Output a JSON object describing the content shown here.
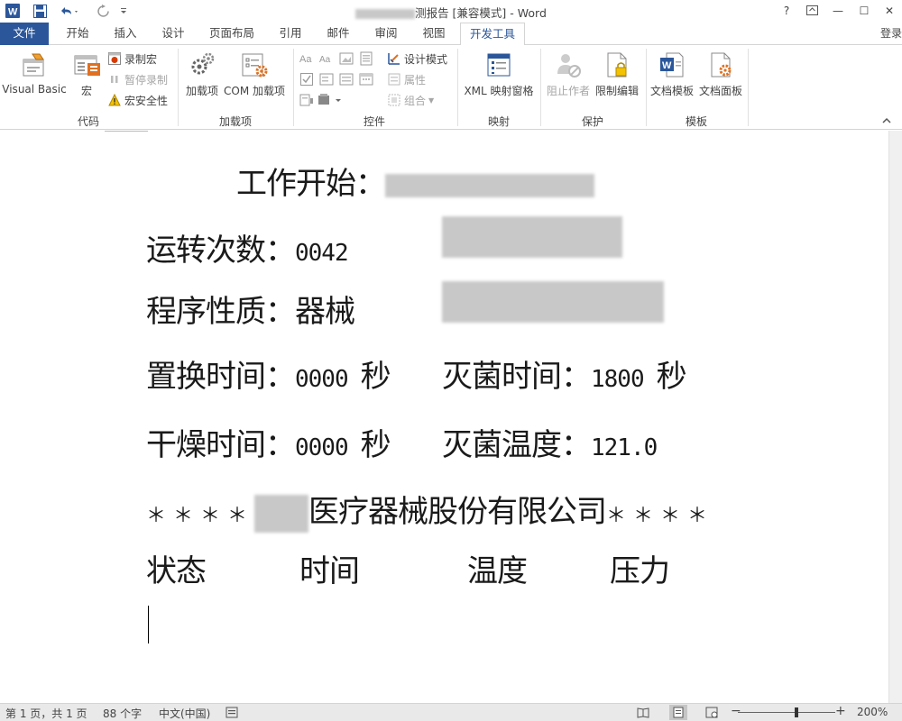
{
  "titlebar": {
    "title_prefix": "测报告 [兼容模式] - Word",
    "help": "?",
    "min": "—",
    "max": "☐",
    "close": "✕"
  },
  "tabs": [
    {
      "label": "文件"
    },
    {
      "label": "开始"
    },
    {
      "label": "插入"
    },
    {
      "label": "设计"
    },
    {
      "label": "页面布局"
    },
    {
      "label": "引用"
    },
    {
      "label": "邮件"
    },
    {
      "label": "审阅"
    },
    {
      "label": "视图"
    },
    {
      "label": "开发工具"
    }
  ],
  "login": "登录",
  "ribbon": {
    "code": {
      "label": "代码",
      "visual_basic": "Visual Basic",
      "macros": "宏",
      "record_macro": "录制宏",
      "pause_recording": "暂停录制",
      "macro_security": "宏安全性"
    },
    "addins": {
      "label": "加载项",
      "addins": "加载项",
      "com_addins": "COM 加载项"
    },
    "controls": {
      "label": "控件",
      "design_mode": "设计模式",
      "properties": "属性",
      "group": "组合"
    },
    "mapping": {
      "label": "映射",
      "xml_pane": "XML 映射窗格"
    },
    "protect": {
      "label": "保护",
      "block_authors": "阻止作者",
      "restrict_editing": "限制编辑"
    },
    "templates": {
      "label": "模板",
      "doc_template": "文档模板",
      "doc_panel": "文档面板"
    }
  },
  "document": {
    "line1_label": "工作开始：",
    "line2_label": "运转次数：",
    "line2_value": "0042",
    "line3_label": "程序性质：",
    "line3_value": "器械",
    "line4_label": "置换时间：",
    "line4_value": "0000",
    "line4_unit": "秒",
    "line4b_label": "灭菌时间：",
    "line4b_value": "1800",
    "line4b_unit": "秒",
    "line5_label": "干燥时间：",
    "line5_value": "0000",
    "line5_unit": "秒",
    "line5b_label": "灭菌温度：",
    "line5b_value": "121.0",
    "line6_stars_left": "＊＊＊＊",
    "line6_company": "医疗器械股份有限公司",
    "line6_stars_right": "＊＊＊＊",
    "header_status": "状态",
    "header_time": "时间",
    "header_temp": "温度",
    "header_pressure": "压力"
  },
  "statusbar": {
    "page": "第 1 页，共 1 页",
    "words": "88 个字",
    "language": "中文(中国)",
    "zoom": "200%",
    "zoom_minus": "−",
    "zoom_plus": "+",
    "zoom_level": 0.6
  },
  "colors": {
    "accent": "#2b579a"
  }
}
